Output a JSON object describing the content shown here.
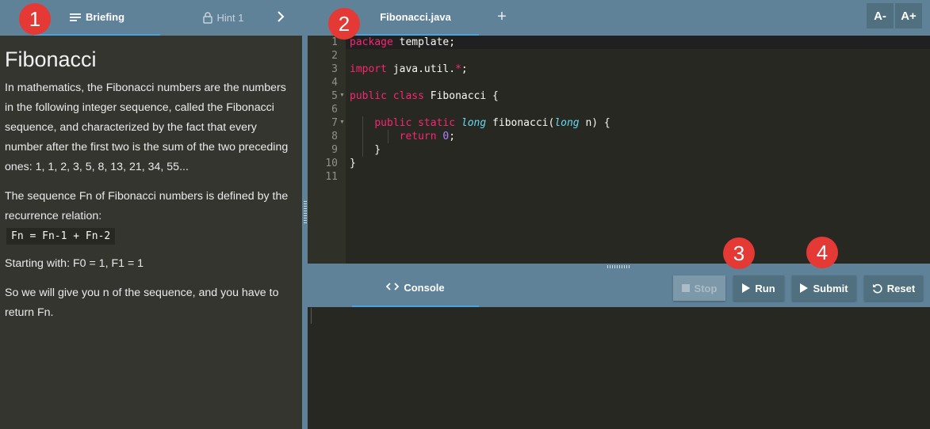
{
  "left_tabs": {
    "briefing": "Briefing",
    "hint": "Hint 1"
  },
  "briefing": {
    "title": "Fibonacci",
    "p1": "In mathematics, the Fibonacci numbers are the numbers in the following integer sequence, called the Fibonacci sequence, and characterized by the fact that every number after the first two is the sum of the two preceding ones: 1, 1, 2, 3, 5, 8, 13, 21, 34, 55...",
    "p2": "The sequence Fn of Fibonacci numbers is defined by the recurrence relation:",
    "formula": "Fn = Fn-1 + Fn-2",
    "p3": "Starting with: F0 = 1, F1 = 1",
    "p4": "So we will give you n of the sequence, and you have to return Fn."
  },
  "editor": {
    "file_tab": "Fibonacci.java",
    "add_tab": "+",
    "font_smaller": "A-",
    "font_larger": "A+",
    "line_numbers": [
      "1",
      "2",
      "3",
      "4",
      "5",
      "6",
      "7",
      "8",
      "9",
      "10",
      "11"
    ]
  },
  "console": {
    "tab": "Console",
    "stop": "Stop",
    "run": "Run",
    "submit": "Submit",
    "reset": "Reset"
  },
  "markers": [
    "1",
    "2",
    "3",
    "4"
  ]
}
